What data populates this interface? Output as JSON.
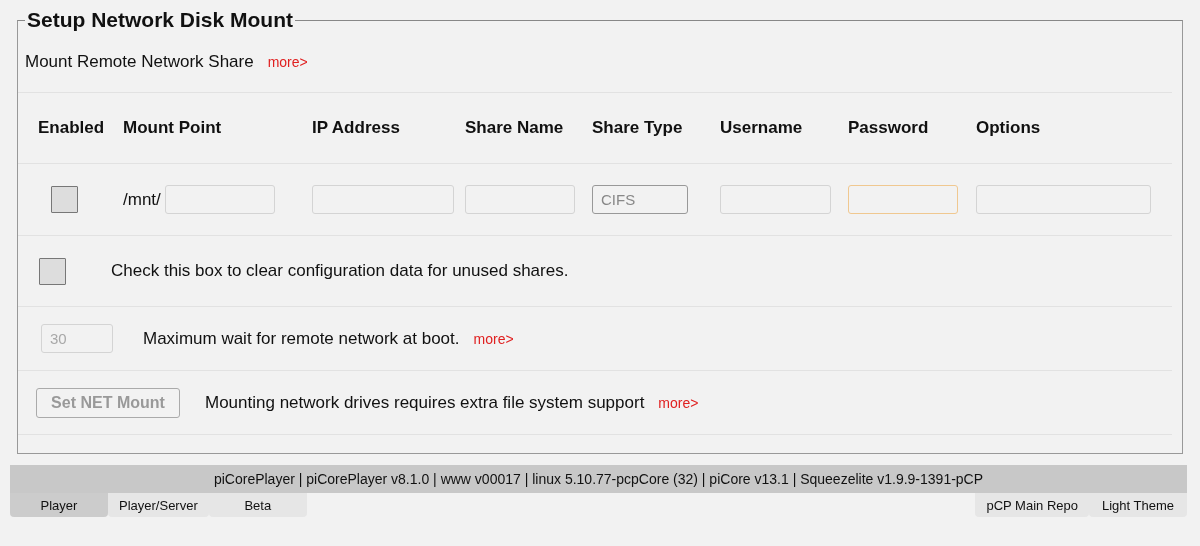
{
  "panel": {
    "title": "Setup Network Disk Mount",
    "intro": {
      "text": "Mount Remote Network Share",
      "link": "more>"
    },
    "columns": [
      "Enabled",
      "Mount Point",
      "IP Address",
      "Share Name",
      "Share Type",
      "Username",
      "Password",
      "Options"
    ],
    "share": {
      "enabled": false,
      "prefix": "/mnt/",
      "fields": [
        {
          "focused": false
        },
        {
          "focused": false
        },
        {
          "focused": false
        },
        {
          "value": "CIFS",
          "focused": false
        },
        {
          "focused": false
        },
        {
          "focused": true
        },
        {
          "focused": false
        }
      ]
    },
    "clear": {
      "checked": false,
      "text": "Check this box to clear configuration data for unused shares."
    },
    "wait": {
      "placeholder": "30",
      "text": "Maximum wait for remote network at boot.",
      "link": "more>"
    },
    "action": {
      "button": "Set NET Mount",
      "disabled": true,
      "text": "Mounting network drives requires extra file system support",
      "link": "more>"
    }
  },
  "status_bar": "piCorePlayer | piCorePlayer v8.1.0 | www v00017 | linux 5.10.77-pcpCore (32) | piCore v13.1 | Squeezelite v1.9.9-1391-pCP",
  "tabs_left": [
    {
      "label": "Player",
      "selected": true
    },
    {
      "label": "Player/Server",
      "selected": false
    },
    {
      "label": "Beta",
      "selected": false
    }
  ],
  "tabs_right": [
    {
      "label": "pCP Main Repo",
      "selected": false
    },
    {
      "label": "Light Theme",
      "selected": false
    }
  ]
}
